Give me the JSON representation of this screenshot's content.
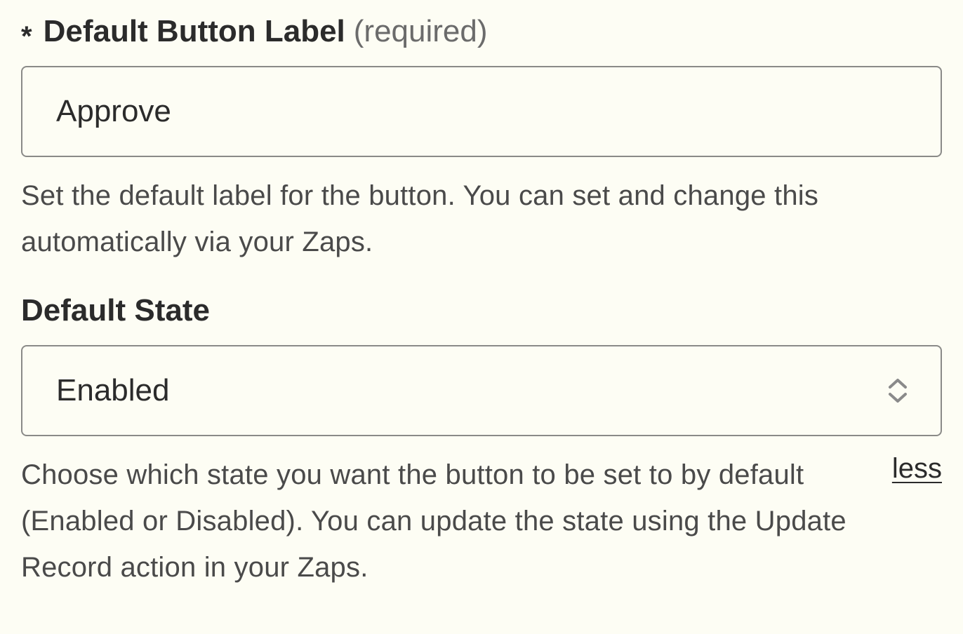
{
  "fields": {
    "buttonLabel": {
      "asterisk": "*",
      "label": "Default Button Label",
      "suffix": "(required)",
      "value": "Approve",
      "help": "Set the default label for the button. You can set and change this automatically via your Zaps."
    },
    "defaultState": {
      "label": "Default State",
      "value": "Enabled",
      "help": "Choose which state you want the button to be set to by default (Enabled or Disabled). You can update the state using the Update Record action in your Zaps.",
      "toggleLink": "less"
    }
  }
}
